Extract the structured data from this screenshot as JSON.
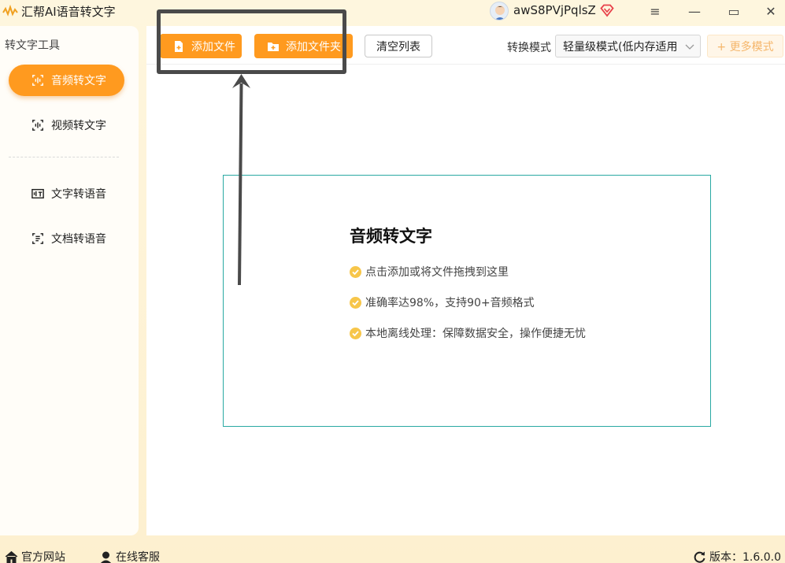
{
  "window": {
    "title": "汇帮AI语音转文字",
    "user_name": "awS8PVjPqlsZ",
    "controls": [
      "≡",
      "—",
      "▭",
      "✕"
    ]
  },
  "sidebar": {
    "section_title": "转文字工具",
    "items": [
      {
        "label": "音频转文字",
        "icon": "audio-wave-icon",
        "active": true
      },
      {
        "label": "视频转文字",
        "icon": "video-text-icon",
        "active": false
      },
      {
        "label": "文字转语音",
        "icon": "text-speech-icon",
        "active": false
      },
      {
        "label": "文档转语音",
        "icon": "doc-speech-icon",
        "active": false
      }
    ]
  },
  "toolbar": {
    "add_file_label": "添加文件",
    "add_folder_label": "添加文件夹",
    "clear_list_label": "清空列表",
    "mode_label": "转换模式",
    "mode_value": "轻量级模式(低内存适用",
    "more_modes_label": "+ 更多模式"
  },
  "dropzone": {
    "title": "音频转文字",
    "points": [
      "点击添加或将文件拖拽到这里",
      "准确率达98%，支持90+音频格式",
      "本地离线处理：保障数据安全，操作便捷无忧"
    ]
  },
  "footer": {
    "website_label": "官方网站",
    "service_label": "在线客服",
    "version_label": "版本：1.6.0.0"
  },
  "colors": {
    "accent": "#ff9a1f",
    "dropzone_border": "#29a9a3",
    "check": "#f7c64a",
    "annotation": "#4a4a4a"
  }
}
